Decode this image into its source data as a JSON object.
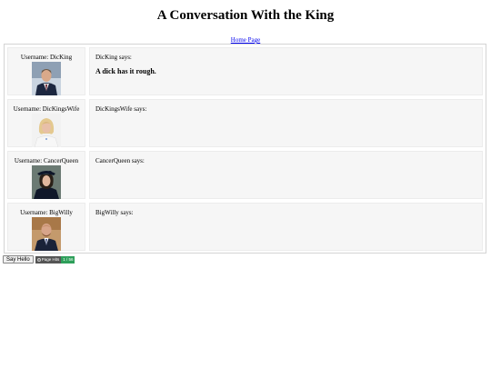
{
  "page": {
    "title": "A Conversation With the King",
    "home_link": "Home Page"
  },
  "posts": [
    {
      "username_label": "Username: DicKing",
      "says": "DicKing says:",
      "message": "A dick has it rough.",
      "avatar_icon": "man-in-suit-portrait"
    },
    {
      "username_label": "Username: DicKingsWife",
      "says": "DicKingsWife says:",
      "message": "",
      "avatar_icon": "woman-blonde-portrait"
    },
    {
      "username_label": "Username: CancerQueen",
      "says": "CancerQueen says:",
      "message": "",
      "avatar_icon": "woman-with-hat-portrait"
    },
    {
      "username_label": "Username: BigWilly",
      "says": "BigWilly says:",
      "message": "",
      "avatar_icon": "bald-man-portrait"
    }
  ],
  "footer": {
    "button_label": "Say Hello",
    "hits_label": "Page Hits",
    "hits_value": "1 / 56"
  }
}
